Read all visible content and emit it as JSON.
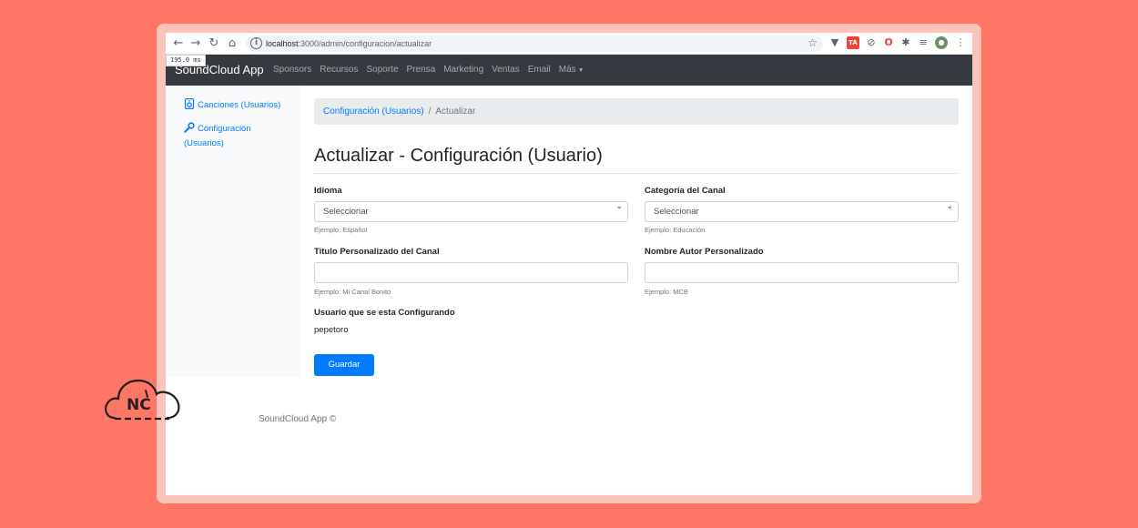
{
  "browser": {
    "url_host": "localhost",
    "url_path": ":3000/admin/configuracion/actualizar",
    "timing_badge": "195.0 ms"
  },
  "navbar": {
    "brand": "SoundCloud App",
    "links": [
      "Sponsors",
      "Recursos",
      "Soporte",
      "Prensa",
      "Marketing",
      "Ventas",
      "Email",
      "Más"
    ]
  },
  "sidebar": {
    "items": [
      {
        "label": "Canciones (Usuarios)",
        "icon": "speaker-icon"
      },
      {
        "label": "Configuración (Usuarios)",
        "icon": "wrench-icon"
      }
    ]
  },
  "breadcrumb": {
    "link": "Configuración (Usuarios)",
    "separator": "/",
    "active": "Actualizar"
  },
  "page": {
    "title": "Actualizar - Configuración (Usuario)"
  },
  "form": {
    "idioma": {
      "label": "Idioma",
      "value": "Seleccionar",
      "help": "Ejemplo: Español"
    },
    "categoria": {
      "label": "Categoría del Canal",
      "value": "Seleccionar",
      "help": "Ejemplo: Educación"
    },
    "titulo": {
      "label": "Titulo Personalizado del Canal",
      "value": "",
      "help": "Ejemplo: Mi Canal Bonito"
    },
    "autor": {
      "label": "Nombre Autor Personalizado",
      "value": "",
      "help": "Ejemplo: MCB"
    },
    "usuario": {
      "label": "Usuario que se esta Configurando",
      "value": "pepetoro"
    },
    "submit_label": "Guardar"
  },
  "footer": {
    "text": "SoundCloud App ©"
  },
  "logo": {
    "text": "NC"
  },
  "colors": {
    "background": "#FE7766",
    "navbar": "#343a40",
    "primary": "#007bff"
  }
}
